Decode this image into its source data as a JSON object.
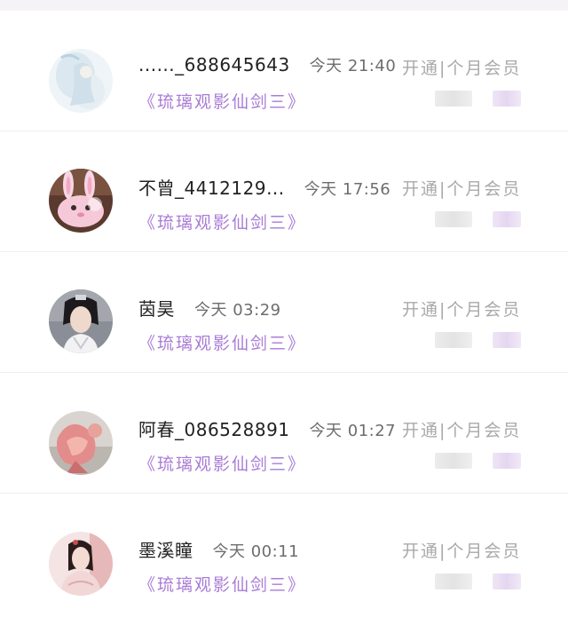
{
  "orders": [
    {
      "username": "......_688645643",
      "time": "今天 21:40",
      "product": "《琉璃观影仙剑三》",
      "membership": "开通|个月会员",
      "avatar_icon": "pale-blue-figure-avatar-icon"
    },
    {
      "username": "不曾_4412129...",
      "time": "今天 17:56",
      "product": "《琉璃观影仙剑三》",
      "membership": "开通|个月会员",
      "avatar_icon": "pink-bunny-avatar-icon"
    },
    {
      "username": "茵昊",
      "time": "今天 03:29",
      "product": "《琉璃观影仙剑三》",
      "membership": "开通|个月会员",
      "avatar_icon": "costume-actor-avatar-icon"
    },
    {
      "username": "阿春_086528891",
      "time": "今天 01:27",
      "product": "《琉璃观影仙剑三》",
      "membership": "开通|个月会员",
      "avatar_icon": "pink-figure-avatar-icon"
    },
    {
      "username": "墨溪瞳",
      "time": "今天 00:11",
      "product": "《琉璃观影仙剑三》",
      "membership": "开通|个月会员",
      "avatar_icon": "red-dress-avatar-icon"
    }
  ],
  "colors": {
    "product_purple": "#a97cd6",
    "membership_gray": "#a9a9a9",
    "username_dark": "#222222",
    "time_gray": "#6d6d6d"
  }
}
